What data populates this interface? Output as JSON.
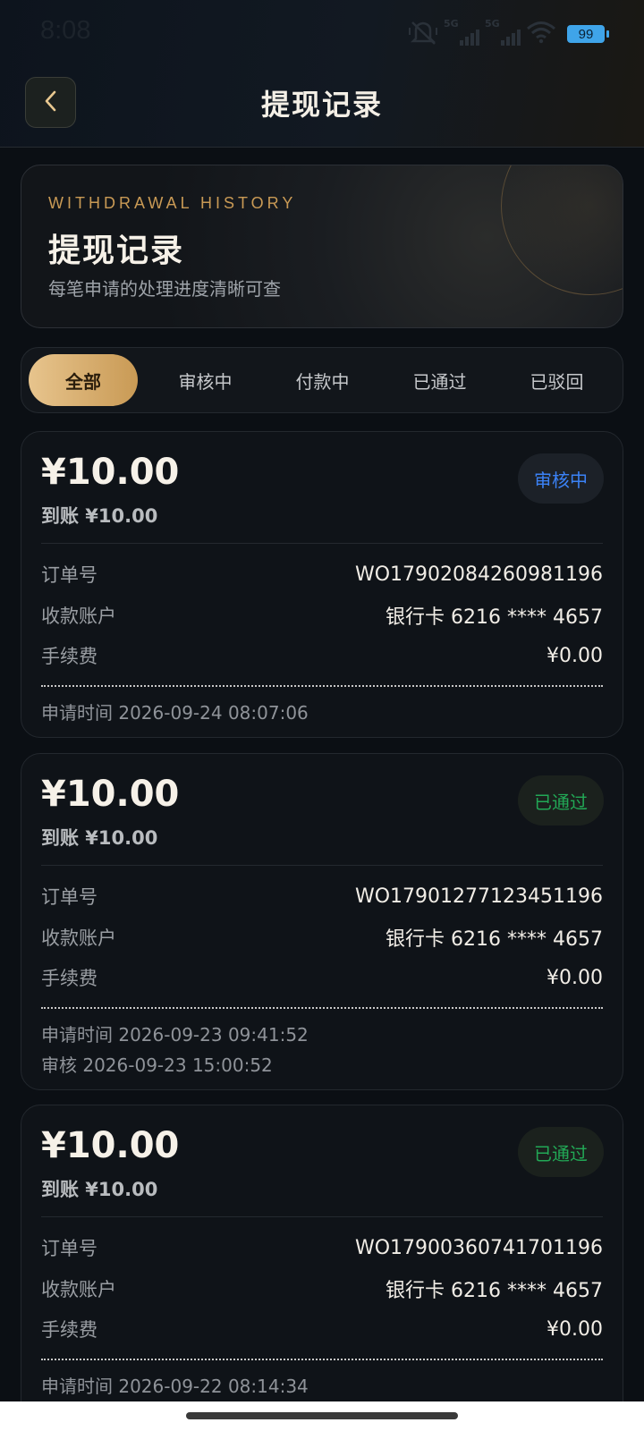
{
  "status_bar": {
    "time": "8:08",
    "signal_label_1": "5G",
    "signal_label_2": "5G",
    "battery": "99",
    "icons": [
      "mute-icon",
      "signal-icon",
      "signal-icon",
      "wifi-icon",
      "battery-icon"
    ]
  },
  "header": {
    "title": "提现记录",
    "back_icon": "chevron-left-icon"
  },
  "hero": {
    "en_title": "WITHDRAWAL HISTORY",
    "title": "提现记录",
    "subtitle": "每笔申请的处理进度清晰可查"
  },
  "tabs": [
    {
      "label": "全部",
      "active": true
    },
    {
      "label": "审核中",
      "active": false
    },
    {
      "label": "付款中",
      "active": false
    },
    {
      "label": "已通过",
      "active": false
    },
    {
      "label": "已驳回",
      "active": false
    }
  ],
  "colors": {
    "accent_gold": "#c99a55",
    "status_reviewing": "#3b82f6",
    "status_approved": "#22a856"
  },
  "records": [
    {
      "amount": "¥10.00",
      "arrival": "到账 ¥10.00",
      "status": "审核中",
      "order_label": "订单号",
      "order_no": "WO17902084260981196",
      "account_label": "收款账户",
      "account": "银行卡 6216 **** 4657",
      "fee_label": "手续费",
      "fee": "¥0.00",
      "apply_time": "申请时间 2026-09-24 08:07:06"
    },
    {
      "amount": "¥10.00",
      "arrival": "到账 ¥10.00",
      "status": "已通过",
      "order_label": "订单号",
      "order_no": "WO17901277123451196",
      "account_label": "收款账户",
      "account": "银行卡 6216 **** 4657",
      "fee_label": "手续费",
      "fee": "¥0.00",
      "apply_time": "申请时间 2026-09-23 09:41:52",
      "review_time": "审核 2026-09-23 15:00:52"
    },
    {
      "amount": "¥10.00",
      "arrival": "到账 ¥10.00",
      "status": "已通过",
      "order_label": "订单号",
      "order_no": "WO17900360741701196",
      "account_label": "收款账户",
      "account": "银行卡 6216 **** 4657",
      "fee_label": "手续费",
      "fee": "¥0.00",
      "apply_time": "申请时间 2026-09-22 08:14:34"
    }
  ]
}
